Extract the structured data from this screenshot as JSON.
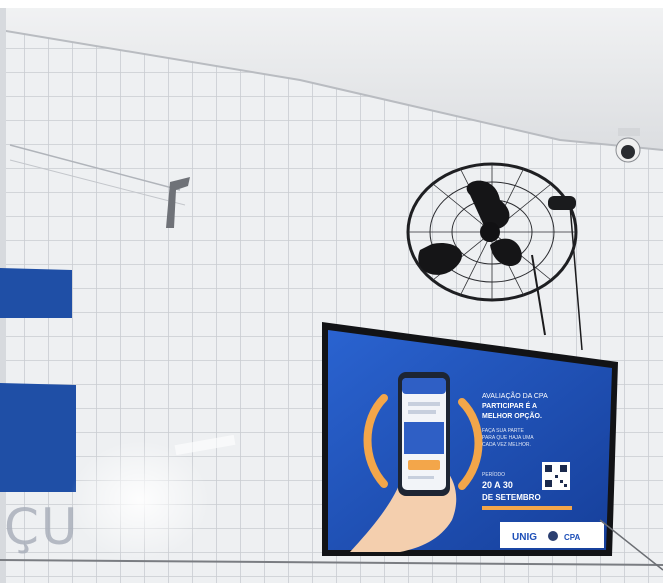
{
  "scene": {
    "colors": {
      "tile": "#eef0f2",
      "grout": "#c9ccd1",
      "ceiling": "#e9eaec",
      "tv_screen": "#1d4fb8",
      "tv_accent": "#f3a64a",
      "wall_sign": "#1f4fa6"
    },
    "wall_sign_letters": "ÇU",
    "tv": {
      "heading": [
        "AVALIAÇÃO DA CPA",
        "PARTICIPAR É A",
        "MELHOR OPÇÃO."
      ],
      "body": [
        "FAÇA SUA PARTE",
        "PARA QUE HAJA UMA",
        "CADA VEZ MELHOR."
      ],
      "period_label": "PERÍODO",
      "period_dates": "20 A 30",
      "period_month": "DE SETEMBRO",
      "logo_unig": "UNIG",
      "logo_cpa": "CPA"
    }
  }
}
